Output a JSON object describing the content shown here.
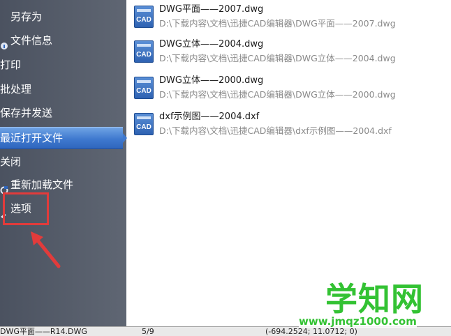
{
  "sidebar": {
    "items": [
      {
        "label": "另存为"
      },
      {
        "label": "文件信息"
      },
      {
        "label": "打印"
      },
      {
        "label": "批处理"
      },
      {
        "label": "保存并发送"
      },
      {
        "label": "最近打开文件"
      },
      {
        "label": "关闭"
      },
      {
        "label": "重新加载文件"
      },
      {
        "label": "选项"
      }
    ],
    "active_item": "最近打开文件"
  },
  "recent_files": [
    {
      "name": "DWG平面——2007.dwg",
      "path": "D:\\下载内容\\文档\\迅捷CAD编辑器\\DWG平面——2007.dwg",
      "icon": "CAD"
    },
    {
      "name": "DWG立体——2004.dwg",
      "path": "D:\\下载内容\\文档\\迅捷CAD编辑器\\DWG立体——2004.dwg",
      "icon": "CAD"
    },
    {
      "name": "DWG立体——2000.dwg",
      "path": "D:\\下载内容\\文档\\迅捷CAD编辑器\\DWG立体——2000.dwg",
      "icon": "CAD"
    },
    {
      "name": "dxf示例图——2004.dxf",
      "path": "D:\\下载内容\\文档\\迅捷CAD编辑器\\dxf示例图——2004.dxf",
      "icon": "CAD"
    }
  ],
  "statusbar": {
    "file": "DWG平面——R14.DWG",
    "page": "5/9",
    "coords": "(-694.2524; 11.0712; 0)"
  },
  "watermark": {
    "logo": "学知网",
    "url": "www.jmqz1000.com"
  },
  "colors": {
    "sidebar": "#555c69",
    "active_item": "#3f79cf",
    "highlight_box": "#e23b3b",
    "watermark": "#33c233"
  }
}
